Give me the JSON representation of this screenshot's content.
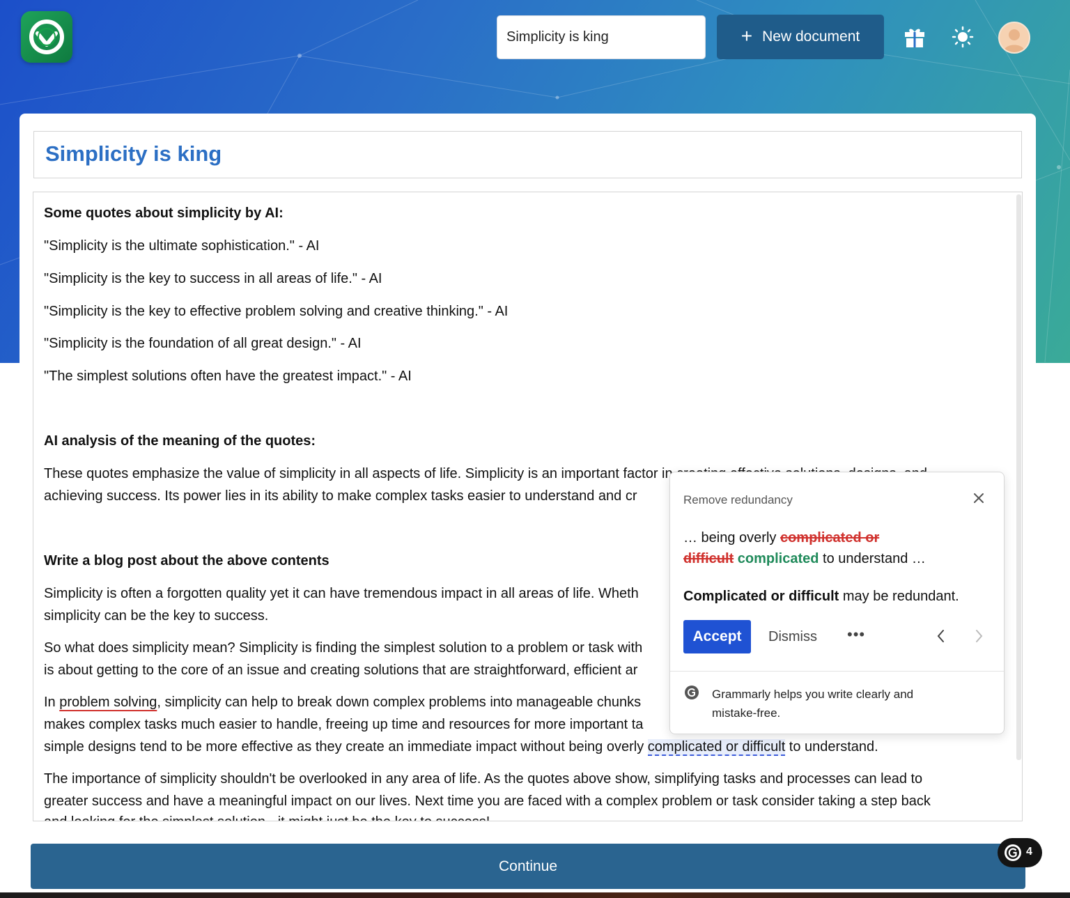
{
  "header": {
    "search_value": "Simplicity is king",
    "new_document_label": "New document",
    "new_document_icon": "plus-icon",
    "icons": [
      "gift-icon",
      "sun-icon",
      "avatar"
    ]
  },
  "document": {
    "title": "Simplicity is king",
    "lines": [
      "Some quotes about simplicity by AI:",
      "\"Simplicity is the ultimate sophistication.\" - AI",
      "\"Simplicity is the key to success in all areas of life.\" - AI",
      "\"Simplicity is the key to effective problem solving and creative thinking.\" - AI",
      "\"Simplicity is the foundation of all great design.\" - AI",
      "\"The simplest solutions often have the greatest impact.\" - AI",
      "AI analysis of the meaning of the quotes:",
      "These quotes emphasize the value of simplicity in all aspects of life. Simplicity is an important factor in creating effective solutions, designs, and",
      "achieving success. Its power lies in its ability to make complex tasks easier to understand and cr",
      "Write a blog post about the above contents",
      "Simplicity is often a forgotten quality yet it can have tremendous impact in all areas of life. Wheth",
      "simplicity can be the key to success.",
      "So what does simplicity mean? Simplicity is finding the simplest solution to a problem or task with",
      "is about getting to the core of an issue and creating solutions that are straightforward, efficient ar",
      "In ",
      "problem solving",
      ", simplicity can help to break down complex problems into manageable chunks",
      "makes complex tasks much easier to handle, freeing up time and resources for more important ta",
      "simple designs tend to be more effective as they create an immediate impact without being overly ",
      "complicated or difficult",
      " to understand.",
      "The importance of simplicity shouldn't be overlooked in any area of life. As the quotes above show, simplifying tasks and processes can lead to",
      "greater success and have a meaningful impact on our lives. Next time you are faced with a complex problem or task consider taking a step back",
      "and looking for the simplest solution - it might just be the key to success!"
    ]
  },
  "grammarly_popup": {
    "title": "Remove redundancy",
    "line1_prefix": "… being overly ",
    "line1_strike": "complicated or",
    "line2_strike": "difficult",
    "line2_insert": "complicated",
    "line2_suffix": " to understand …",
    "explanation_bold": "Complicated or difficult",
    "explanation_rest": " may be redundant.",
    "accept_label": "Accept",
    "dismiss_label": "Dismiss",
    "more_label": "•••",
    "footer_text_1": "Grammarly helps you write clearly and",
    "footer_text_2": "mistake-free.",
    "colors": {
      "accept": "#1f52d3",
      "strike": "#d0312d",
      "insert": "#1f8a5a"
    }
  },
  "footer": {
    "continue_label": "Continue",
    "grammarly_count": "4"
  }
}
